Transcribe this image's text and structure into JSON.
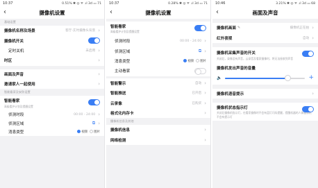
{
  "screen1": {
    "status": {
      "time": "10:37",
      "right": "0.51%  ✱ ◎ ᯤ .ıl 3d ▭ 71"
    },
    "title": "摄像机设置",
    "section_basic": "基础设置",
    "rows": {
      "name": {
        "label": "摄像机名称及场景",
        "value": "客厅-实时摄像头背景",
        "chev": "›"
      },
      "power": {
        "label": "摄像机开关"
      },
      "timer": {
        "label": "定时关机",
        "value": "未启用",
        "chev": "›"
      },
      "timezone": {
        "label": "时区",
        "chev": "›"
      },
      "av": {
        "label": "画面及声音",
        "chev": "›"
      },
      "invite": {
        "label": "邀请家人一起使用",
        "chev": "›"
      }
    },
    "section_smart": "智能看家及安防设置",
    "guard": {
      "label": "智能看家",
      "sub": "高级看护计划及提醒设置"
    },
    "period": {
      "label": "侦测时段",
      "value": "00:00 - 24:00",
      "chev": "›"
    },
    "area": {
      "label": "侦测区域",
      "icon": "⧉",
      "chev": "›"
    },
    "msg_type": {
      "label": "消息类型",
      "opt1": "视频",
      "opt2": "图片"
    }
  },
  "screen2": {
    "status": {
      "time": "10:37",
      "right": "0.28% ✱ ◎ ᯤ .ıl 3d ▭ 71"
    },
    "title": "摄像机设置",
    "guard": {
      "label": "智能看家",
      "sub": "高级看护计划及提醒设置"
    },
    "period": {
      "label": "侦测时段",
      "value": "00:00 - 24:00",
      "chev": "›"
    },
    "area": {
      "label": "侦测区域",
      "icon": "⧉",
      "chev": "›"
    },
    "msg_type": {
      "label": "消息类型",
      "opt1": "视频",
      "opt2": "图片"
    },
    "proactive": {
      "label": "主动看家"
    },
    "alert": {
      "label": "智能警示",
      "value": "自动",
      "chev": "›"
    },
    "push": {
      "label": "智能推送",
      "value": "已开启",
      "chev": "›"
    },
    "cloud": {
      "label": "云录像",
      "value": "已购买",
      "chev": "›"
    },
    "format": {
      "label": "格式化内存卡",
      "chev": "›"
    },
    "section_info": "摄像机信息及其他",
    "info": {
      "label": "摄像机信息",
      "chev": "›"
    },
    "network": {
      "label": "网络检测",
      "chev": "›"
    }
  },
  "screen3": {
    "status": {
      "time": "10:46",
      "right": "3.21% ✱ ◎ ᯤ .ıl 3d ▭ 68"
    },
    "title": "画面及声音",
    "camera_image": {
      "label": "摄像机画面",
      "value": "摄像机正在拍",
      "chev": "›"
    },
    "night": {
      "label": "红外夜视",
      "value": "自动",
      "chev": "›"
    },
    "audio_switch": {
      "label": "摄像机采集声音的开关",
      "sub": "关闭后，录像没有声音，云录音及看家摄像时，将无法接收到声音"
    },
    "volume": {
      "label": "摄像机发出声音的音量",
      "level": 0.78,
      "minus_icon": "🔈",
      "plus_icon": "+"
    },
    "voice_prompt": {
      "label": "摄像机语音提示",
      "chev": "›"
    },
    "status_light": {
      "label": "摄像机状态指示灯",
      "sub": "关闭后摄像机指示灯，在看家摄像时不会有蓝灯闪烁提醒，提醒机器的人体摄像机不会有提示灯"
    }
  },
  "colors": {
    "accent": "#3a7ef4",
    "bg": "#f2f2f4"
  }
}
